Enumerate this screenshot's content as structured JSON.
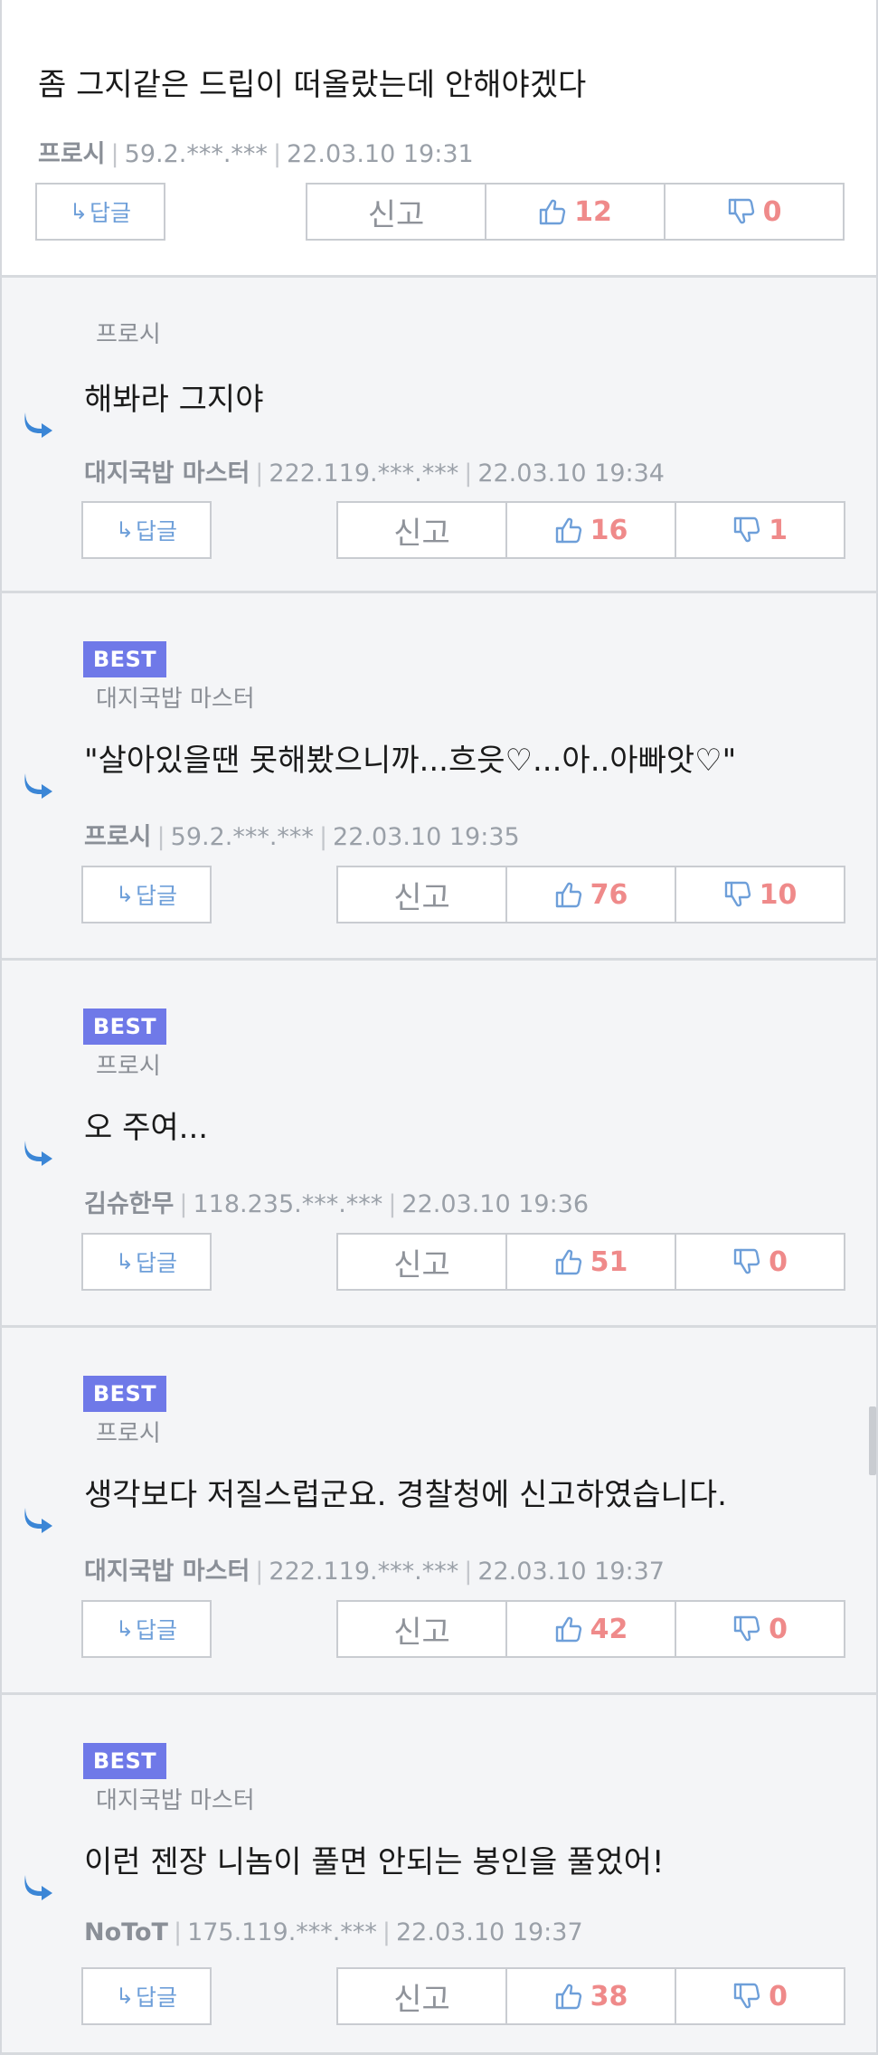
{
  "ui": {
    "reply_label": "답글",
    "report_label": "신고"
  },
  "comments": [
    {
      "best": false,
      "parent": "",
      "text": "좀 그지같은 드립이 떠올랐는데 안해야겠다",
      "author": "프로시",
      "ip": "59.2.***.***",
      "date": "22.03.10 19:31",
      "likes": "12",
      "dislikes": "0"
    },
    {
      "best": false,
      "parent": "프로시",
      "text": "해봐라 그지야",
      "author": "대지국밥 마스터",
      "ip": "222.119.***.***",
      "date": "22.03.10 19:34",
      "likes": "16",
      "dislikes": "1"
    },
    {
      "best": true,
      "best_label": "BEST",
      "parent": "대지국밥 마스터",
      "text": "\"살아있을땐 못해봤으니까...흐읏♡...아..아빠앗♡\"",
      "author": "프로시",
      "ip": "59.2.***.***",
      "date": "22.03.10 19:35",
      "likes": "76",
      "dislikes": "10"
    },
    {
      "best": true,
      "best_label": "BEST",
      "parent": "프로시",
      "text": "오 주여...",
      "author": "김슈한무",
      "ip": "118.235.***.***",
      "date": "22.03.10 19:36",
      "likes": "51",
      "dislikes": "0"
    },
    {
      "best": true,
      "best_label": "BEST",
      "parent": "프로시",
      "text": "생각보다 저질스럽군요. 경찰청에 신고하였습니다.",
      "author": "대지국밥 마스터",
      "ip": "222.119.***.***",
      "date": "22.03.10 19:37",
      "likes": "42",
      "dislikes": "0"
    },
    {
      "best": true,
      "best_label": "BEST",
      "parent": "대지국밥 마스터",
      "text": "이런 젠장 니놈이 풀면 안되는 봉인을 풀었어!",
      "author": "NoToT",
      "ip": "175.119.***.***",
      "date": "22.03.10 19:37",
      "likes": "38",
      "dislikes": "0"
    }
  ],
  "colors": {
    "best_badge": "#6f79e8",
    "count": "#ef8a8a",
    "thumb_icon": "#6e9fd9",
    "reply_arrow": "#3b86d6",
    "reply_bg": "#f4f5f7"
  },
  "icons": [
    "reply-arrow-icon",
    "thumbs-up-icon",
    "thumbs-down-icon"
  ]
}
